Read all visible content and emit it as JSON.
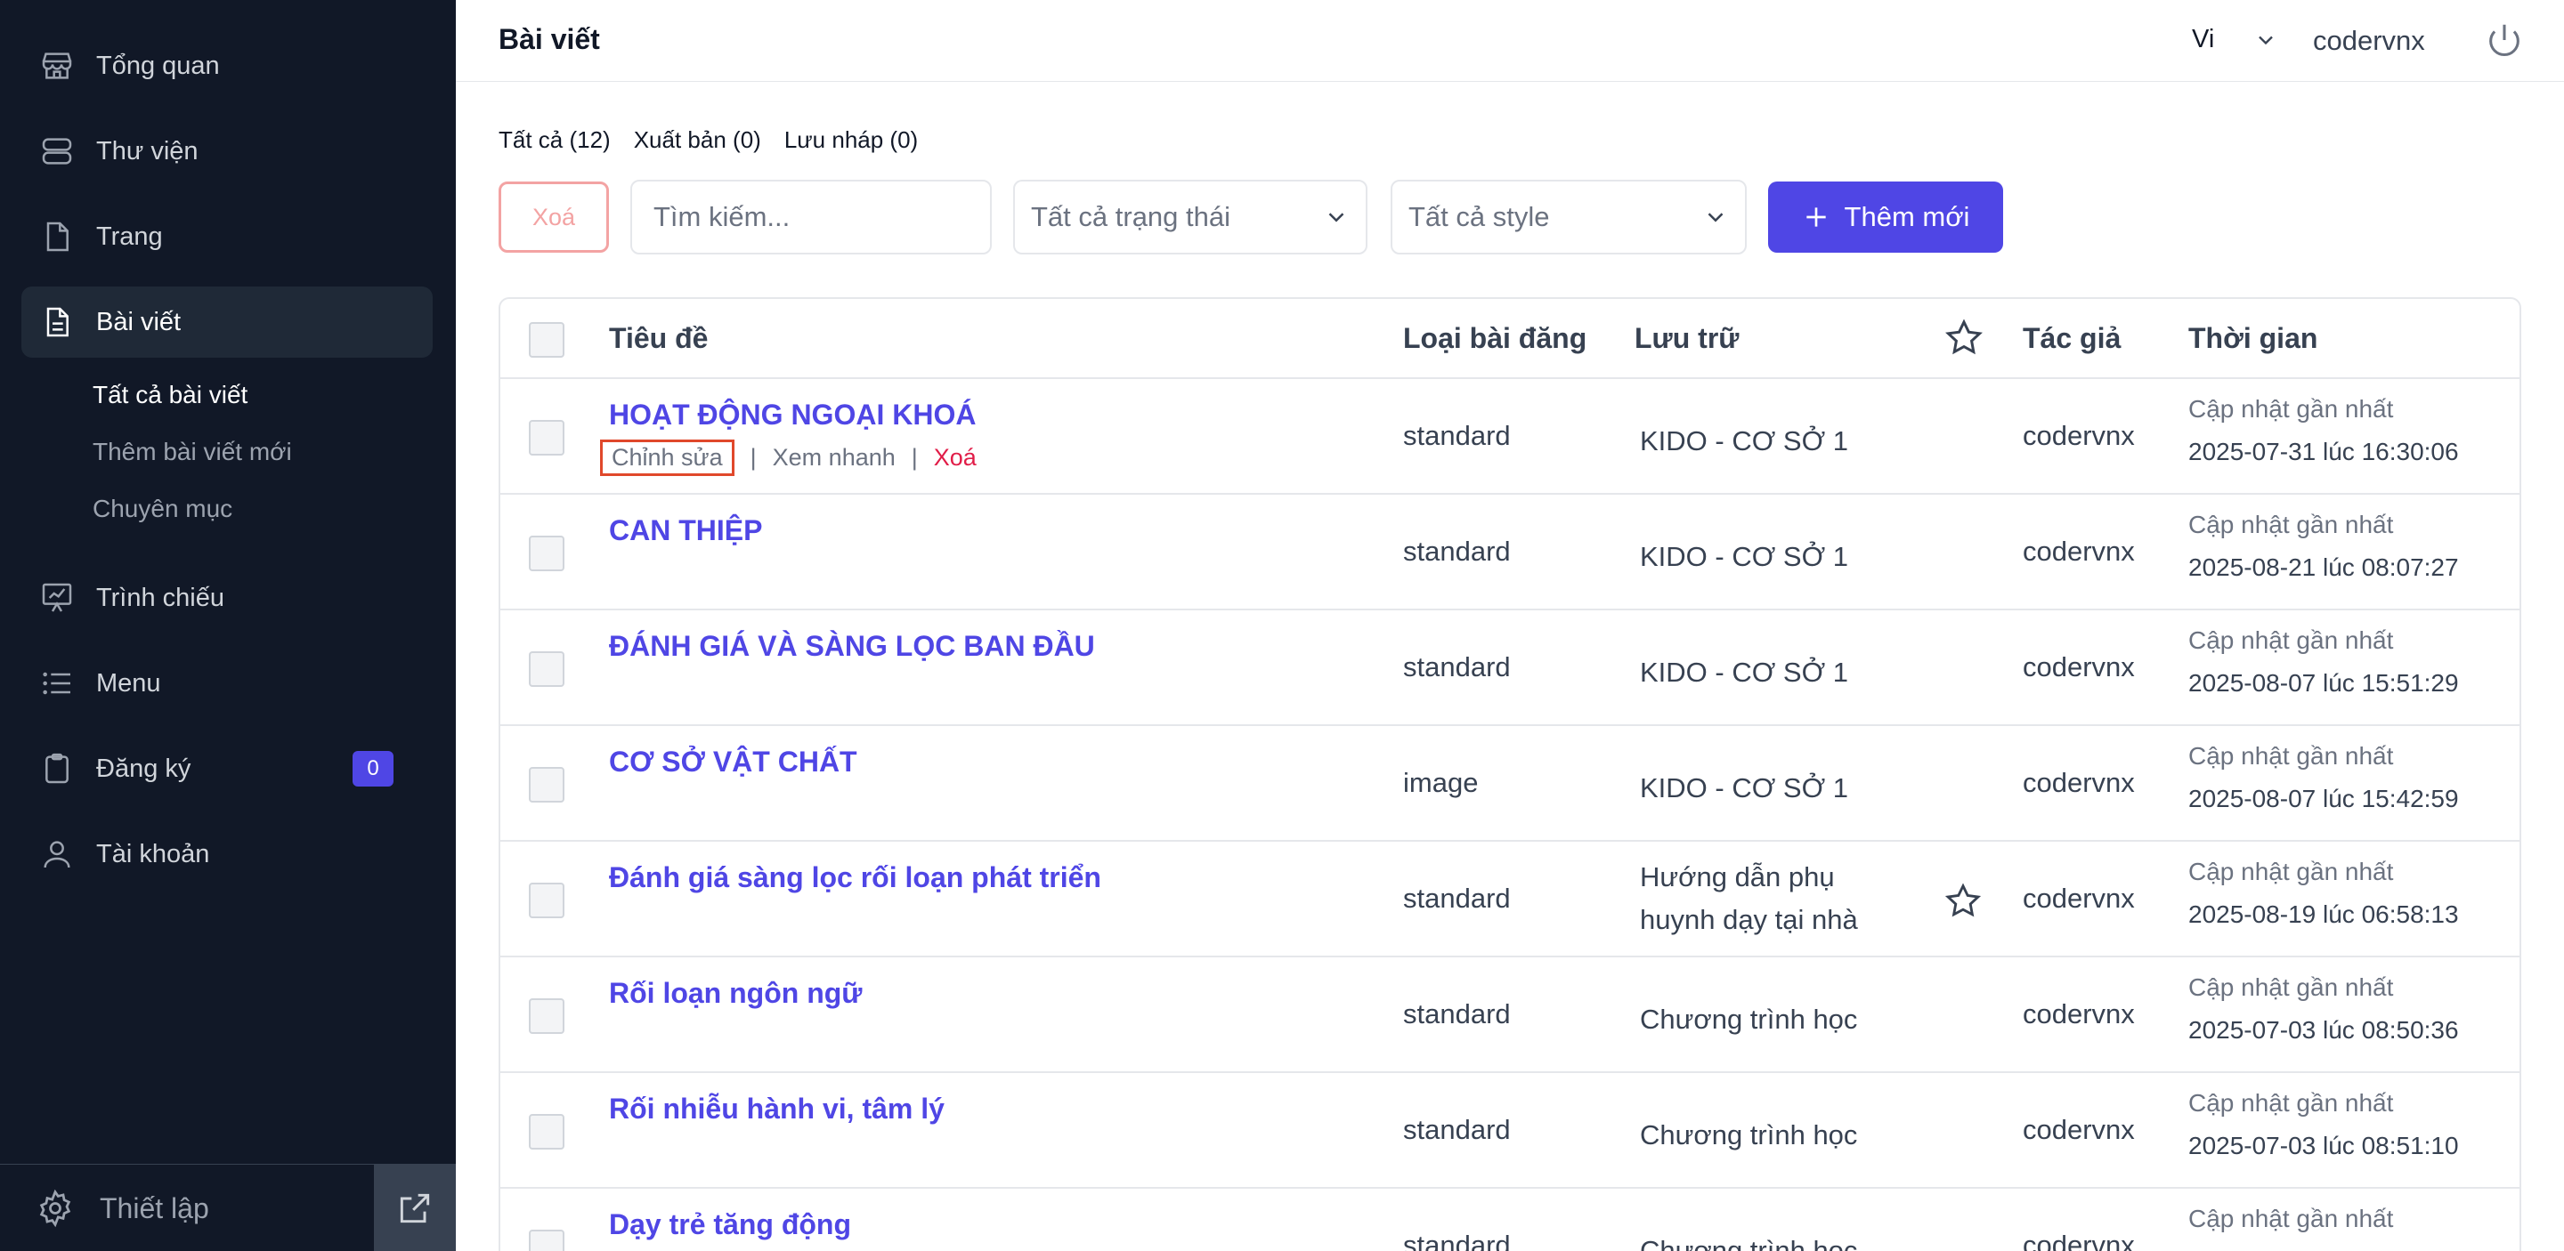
{
  "sidebar": {
    "items": [
      {
        "label": "Tổng quan",
        "icon": "store-icon"
      },
      {
        "label": "Thư viện",
        "icon": "database-icon"
      },
      {
        "label": "Trang",
        "icon": "file-icon"
      },
      {
        "label": "Bài viết",
        "icon": "document-icon"
      },
      {
        "label": "Trình chiếu",
        "icon": "presentation-icon"
      },
      {
        "label": "Menu",
        "icon": "list-icon"
      },
      {
        "label": "Đăng ký",
        "icon": "clipboard-icon",
        "badge": "0"
      },
      {
        "label": "Tài khoản",
        "icon": "user-icon"
      }
    ],
    "subitems": [
      "Tất cả bài viết",
      "Thêm bài viết mới",
      "Chuyên mục"
    ],
    "settings_label": "Thiết lập"
  },
  "header": {
    "title": "Bài viết",
    "language": "Vi",
    "username": "codervnx"
  },
  "filters": {
    "all": "Tất cả (12)",
    "published": "Xuất bản (0)",
    "draft": "Lưu nháp (0)"
  },
  "toolbar": {
    "delete_label": "Xoá",
    "search_placeholder": "Tìm kiếm...",
    "status_select": "Tất cả trạng thái",
    "style_select": "Tất cả style",
    "add_label": "Thêm mới"
  },
  "table": {
    "headers": {
      "title": "Tiêu đề",
      "type": "Loại bài đăng",
      "storage": "Lưu trữ",
      "author": "Tác giả",
      "time": "Thời gian"
    },
    "row_actions": {
      "edit": "Chỉnh sửa",
      "separator": "|",
      "preview": "Xem nhanh",
      "delete": "Xoá"
    },
    "time_label": "Cập nhật gần nhất",
    "rows": [
      {
        "title": "HOẠT ĐỘNG NGOẠI KHOÁ",
        "type": "standard",
        "storage": "KIDO - CƠ SỞ 1",
        "starred": false,
        "author": "codervnx",
        "time": "2025-07-31 lúc 16:30:06"
      },
      {
        "title": "CAN THIỆP",
        "type": "standard",
        "storage": "KIDO - CƠ SỞ 1",
        "starred": false,
        "author": "codervnx",
        "time": "2025-08-21 lúc 08:07:27"
      },
      {
        "title": "ĐÁNH GIÁ VÀ SÀNG LỌC BAN ĐẦU",
        "type": "standard",
        "storage": "KIDO - CƠ SỞ 1",
        "starred": false,
        "author": "codervnx",
        "time": "2025-08-07 lúc 15:51:29"
      },
      {
        "title": "CƠ SỞ VẬT CHẤT",
        "type": "image",
        "storage": "KIDO - CƠ SỞ 1",
        "starred": false,
        "author": "codervnx",
        "time": "2025-08-07 lúc 15:42:59"
      },
      {
        "title": "Đánh giá sàng lọc rối loạn phát triển",
        "type": "standard",
        "storage": "Hướng dẫn phụ huynh dạy tại nhà",
        "starred": true,
        "author": "codervnx",
        "time": "2025-08-19 lúc 06:58:13"
      },
      {
        "title": "Rối loạn ngôn ngữ",
        "type": "standard",
        "storage": "Chương trình học",
        "starred": false,
        "author": "codervnx",
        "time": "2025-07-03 lúc 08:50:36"
      },
      {
        "title": "Rối nhiễu hành vi, tâm lý",
        "type": "standard",
        "storage": "Chương trình học",
        "starred": false,
        "author": "codervnx",
        "time": "2025-07-03 lúc 08:51:10"
      },
      {
        "title": "Dạy trẻ tăng động",
        "type": "standard",
        "storage": "Chương trình học",
        "starred": false,
        "author": "codervnx",
        "time": ""
      }
    ]
  },
  "colors": {
    "sidebar_bg": "#111827",
    "accent": "#4f46e5",
    "danger": "#e11d48"
  }
}
